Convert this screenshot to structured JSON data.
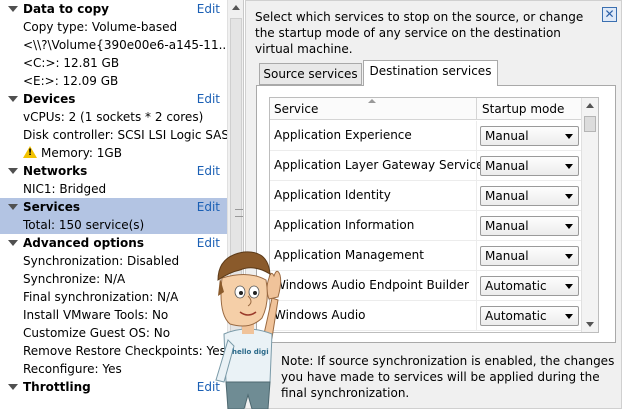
{
  "left_panel": {
    "sections": [
      {
        "title": "Data to copy",
        "edit": "Edit",
        "lines": [
          "Copy type: Volume-based",
          "<\\\\?\\Volume{390e00e6-a145-11...",
          "<C:>: 12.81 GB",
          "<E:>: 12.09 GB"
        ]
      },
      {
        "title": "Devices",
        "edit": "Edit",
        "lines": [
          "vCPUs: 2 (1 sockets * 2 cores)",
          "Disk controller: SCSI LSI Logic SAS"
        ],
        "warning_line": "Memory: 1GB"
      },
      {
        "title": "Networks",
        "edit": "Edit",
        "lines": [
          "NIC1: Bridged"
        ]
      },
      {
        "title": "Services",
        "edit": "Edit",
        "lines": [
          "Total: 150 service(s)"
        ],
        "selected": true
      },
      {
        "title": "Advanced options",
        "edit": "Edit",
        "lines": [
          "Synchronization: Disabled",
          "Synchronize: N/A",
          "Final synchronization: N/A",
          "Install VMware Tools: No",
          "Customize Guest OS: No",
          "Remove Restore Checkpoints: Yes",
          "Reconfigure: Yes"
        ]
      },
      {
        "title": "Throttling",
        "edit": "Edit",
        "lines": []
      }
    ]
  },
  "right_panel": {
    "description": "Select which services to stop on the source, or change the startup mode of any service on the destination virtual machine.",
    "close_icon": "close-icon",
    "tabs": [
      "Source services",
      "Destination services"
    ],
    "active_tab": "Destination services",
    "table": {
      "columns": [
        "Service",
        "Startup mode"
      ],
      "rows": [
        {
          "service": "Application Experience",
          "mode": "Manual"
        },
        {
          "service": "Application Layer Gateway Service",
          "mode": "Manual"
        },
        {
          "service": "Application Identity",
          "mode": "Manual"
        },
        {
          "service": "Application Information",
          "mode": "Manual"
        },
        {
          "service": "Application Management",
          "mode": "Manual"
        },
        {
          "service": "Windows Audio Endpoint Builder",
          "mode": "Automatic"
        },
        {
          "service": "Windows Audio",
          "mode": "Automatic"
        }
      ]
    },
    "note": "Note: If source synchronization is enabled, the changes you have made to services will be applied during the final synchronization."
  },
  "overlay": {
    "mascot_shirt_text": "hello digi"
  },
  "colors": {
    "selected_bg": "#b3c4e3",
    "link": "#1a5fb4",
    "warning": "#f2c200"
  }
}
